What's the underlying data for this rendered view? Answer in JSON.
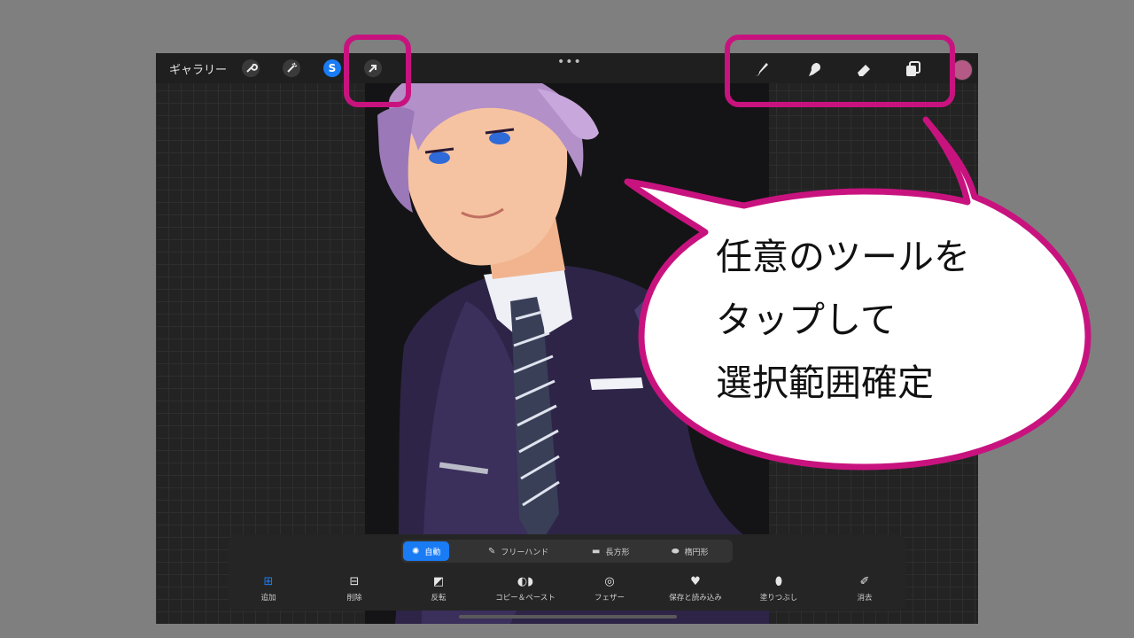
{
  "topbar": {
    "gallery_label": "ギャラリー",
    "left_icons": [
      "wrench-icon",
      "magic-wand-icon",
      "selection-s-icon",
      "arrow-transform-icon"
    ],
    "more_dots": "•••",
    "right_icons": [
      "brush-icon",
      "smudge-icon",
      "eraser-icon",
      "layers-icon"
    ],
    "current_color": "#b45a84"
  },
  "selection_modes": [
    {
      "label": "自動",
      "icon": "auto-icon",
      "active": true
    },
    {
      "label": "フリーハンド",
      "icon": "freehand-icon",
      "active": false
    },
    {
      "label": "長方形",
      "icon": "rectangle-icon",
      "active": false
    },
    {
      "label": "楕円形",
      "icon": "ellipse-icon",
      "active": false
    }
  ],
  "selection_actions": [
    {
      "label": "追加",
      "icon": "plus-icon"
    },
    {
      "label": "削除",
      "icon": "minus-icon"
    },
    {
      "label": "反転",
      "icon": "invert-icon"
    },
    {
      "label": "コピー＆ペースト",
      "icon": "copy-paste-icon"
    },
    {
      "label": "フェザー",
      "icon": "feather-icon"
    },
    {
      "label": "保存と読み込み",
      "icon": "heart-icon"
    },
    {
      "label": "塗りつぶし",
      "icon": "fill-icon"
    },
    {
      "label": "消去",
      "icon": "clear-icon"
    }
  ],
  "callout": {
    "line1": "任意のツールを",
    "line2": "タップして",
    "line3": "選択範囲確定",
    "accent_color": "#c8137f"
  }
}
